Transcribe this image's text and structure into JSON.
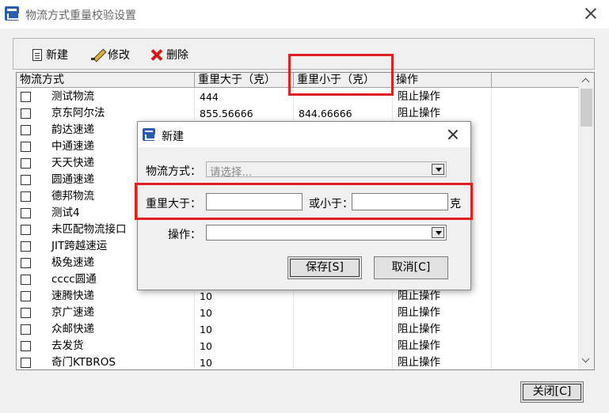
{
  "window": {
    "title": "物流方式重量校验设置",
    "close_label": "关闭[C]"
  },
  "toolbar": {
    "new_label": "新建",
    "edit_label": "修改",
    "delete_label": "删除"
  },
  "grid": {
    "columns": [
      "物流方式",
      "重里大于（克）",
      "重里小于（克）",
      "操作"
    ],
    "rows": [
      {
        "name": "测试物流",
        "gt": "444",
        "lt": "",
        "op": "阻止操作"
      },
      {
        "name": "京东阿尔法",
        "gt": "855.56666",
        "lt": "844.66666",
        "op": "阻止操作"
      },
      {
        "name": "韵达速递",
        "gt": "",
        "lt": "",
        "op": ""
      },
      {
        "name": "中通速递",
        "gt": "",
        "lt": "",
        "op": ""
      },
      {
        "name": "天天快递",
        "gt": "",
        "lt": "",
        "op": ""
      },
      {
        "name": "圆通速递",
        "gt": "",
        "lt": "",
        "op": ""
      },
      {
        "name": "德邦物流",
        "gt": "",
        "lt": "",
        "op": ""
      },
      {
        "name": "测试4",
        "gt": "",
        "lt": "",
        "op": ""
      },
      {
        "name": "未匹配物流接口",
        "gt": "",
        "lt": "",
        "op": ""
      },
      {
        "name": "JIT跨越速运",
        "gt": "",
        "lt": "",
        "op": ""
      },
      {
        "name": "极兔速递",
        "gt": "",
        "lt": "",
        "op": ""
      },
      {
        "name": "cccc圆通",
        "gt": "",
        "lt": "",
        "op": ""
      },
      {
        "name": "速腾快递",
        "gt": "10",
        "lt": "",
        "op": "阻止操作"
      },
      {
        "name": "京广速递",
        "gt": "10",
        "lt": "",
        "op": "阻止操作"
      },
      {
        "name": "众邮快递",
        "gt": "10",
        "lt": "",
        "op": "阻止操作"
      },
      {
        "name": "去发货",
        "gt": "10",
        "lt": "",
        "op": "阻止操作"
      },
      {
        "name": "奇门KTBROS",
        "gt": "10",
        "lt": "",
        "op": "阻止操作"
      }
    ]
  },
  "dialog": {
    "title": "新建",
    "logistics_label": "物流方式：",
    "logistics_placeholder": "请选择...",
    "weight_gt_label": "重里大于：",
    "weight_gt_value": "",
    "weight_lt_label": "或小于：",
    "weight_lt_value": "",
    "unit_label": "克",
    "operation_label": "操作：",
    "operation_value": "",
    "save_label": "保存[S]",
    "cancel_label": "取消[C]"
  },
  "highlight_color": "#e02020"
}
